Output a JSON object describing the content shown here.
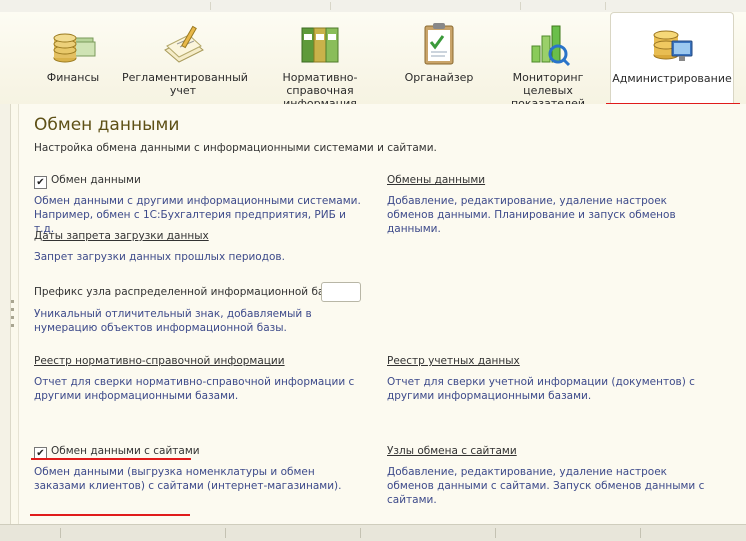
{
  "toolbar": {
    "items": [
      {
        "label": "Финансы",
        "icon": "coins-icon"
      },
      {
        "label": "Регламентированный учет",
        "icon": "ledger-icon"
      },
      {
        "label": "Нормативно-справочная информация",
        "icon": "binders-icon"
      },
      {
        "label": "Органайзер",
        "icon": "clipboard-check-icon"
      },
      {
        "label": "Мониторинг целевых показателей",
        "icon": "bar-chart-icon"
      },
      {
        "label": "Администрирование",
        "icon": "database-monitor-icon",
        "active": true
      }
    ]
  },
  "panel": {
    "title": "Обмен данными",
    "subtitle": "Настройка обмена данными с информационными системами и сайтами.",
    "data_exchange": {
      "checkbox_label": "Обмен данными",
      "checked": true,
      "description": "Обмен данными с другими информационными системами. Например, обмен с 1С:Бухгалтерия предприятия, РИБ и т.д."
    },
    "exchanges_link": {
      "label": "Обмены данными",
      "description": "Добавление, редактирование, удаление настроек обменов данными. Планирование и запуск обменов данными."
    },
    "restriction_link": {
      "label": "Даты запрета загрузки данных",
      "description": "Запрет загрузки данных прошлых периодов."
    },
    "prefix": {
      "label": "Префикс узла распределенной информационной базы:",
      "value": "",
      "description": "Уникальный отличительный знак, добавляемый в нумерацию объектов информационной базы."
    },
    "nsi_registry": {
      "label": "Реестр нормативно-справочной информации",
      "description": "Отчет для сверки нормативно-справочной информации с другими информационными базами."
    },
    "accounting_registry": {
      "label": "Реестр учетных данных",
      "description": "Отчет для сверки учетной информации (документов) с другими информационными базами."
    },
    "site_exchange": {
      "checkbox_label": "Обмен данными с сайтами",
      "checked": true,
      "description": "Обмен данными (выгрузка номенклатуры и обмен заказами клиентов) с сайтами (интернет-магазинами)."
    },
    "site_nodes": {
      "label": "Узлы обмена с сайтами",
      "description": "Добавление, редактирование, удаление настроек обменов данными с сайтами. Запуск обменов данными с сайтами."
    }
  },
  "colors": {
    "highlight": "#e01b1b",
    "title": "#5e5016",
    "description": "#3d4a8a"
  }
}
